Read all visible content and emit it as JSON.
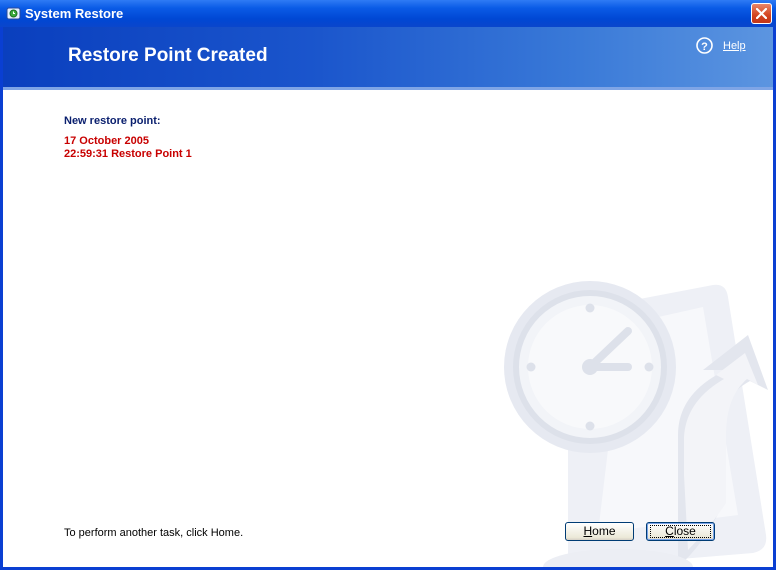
{
  "window": {
    "title": "System Restore"
  },
  "header": {
    "title": "Restore Point Created",
    "help_label": "Help"
  },
  "content": {
    "new_point_label": "New restore point:",
    "restore_date": "17 October 2005",
    "restore_time_name": "22:59:31  Restore Point 1",
    "hint": "To perform another task, click Home."
  },
  "buttons": {
    "home_first": "H",
    "home_rest": "ome",
    "close_first": "C",
    "close_rest": "lose"
  },
  "colors": {
    "title_bar": "#0a5be6",
    "header_bg": "#1a55cc",
    "label_blue": "#0a1f6e",
    "restore_text_red": "#c80000"
  },
  "icons": {
    "app": "system-restore-icon",
    "close": "close-icon",
    "help": "help-icon",
    "watermark": "clock-restore-watermark"
  }
}
